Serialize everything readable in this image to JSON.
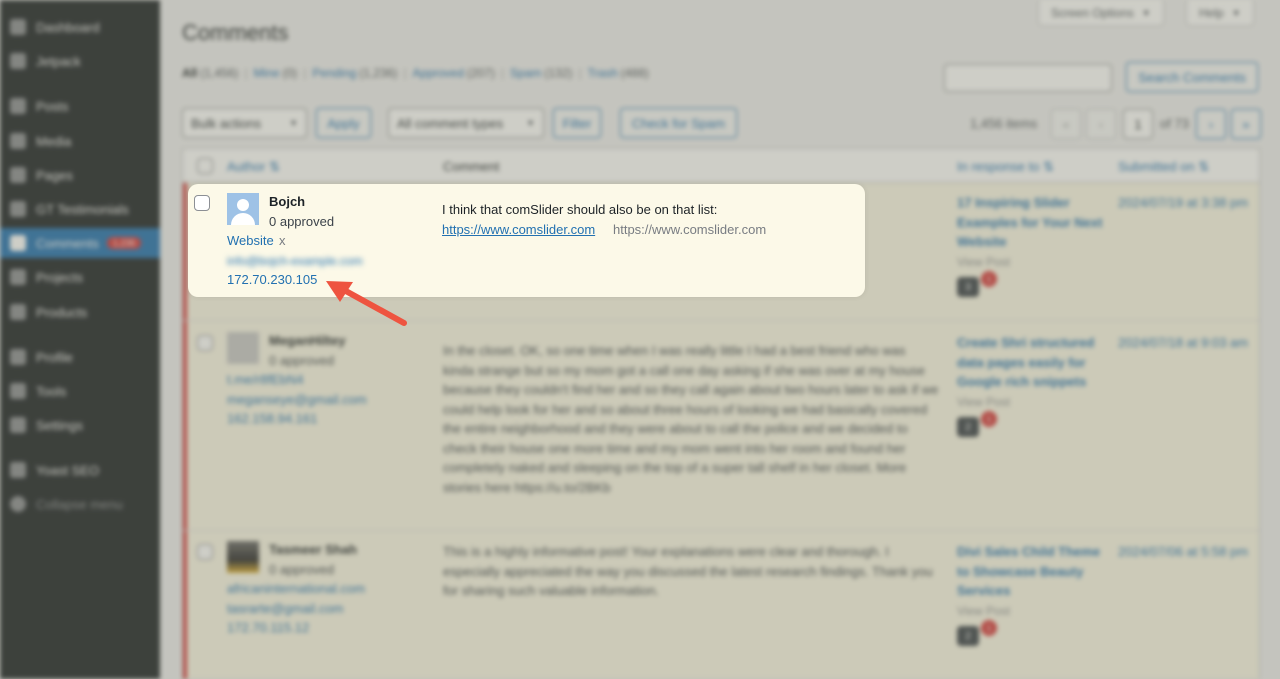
{
  "sidebar": {
    "items": [
      {
        "label": "Dashboard"
      },
      {
        "label": "Jetpack"
      },
      {
        "label": "Posts"
      },
      {
        "label": "Media"
      },
      {
        "label": "Pages"
      },
      {
        "label": "GT Testimonials"
      },
      {
        "label": "Comments",
        "badge": "1,236"
      },
      {
        "label": "Projects"
      },
      {
        "label": "Products"
      },
      {
        "label": "Profile"
      },
      {
        "label": "Tools"
      },
      {
        "label": "Settings"
      },
      {
        "label": "Yoast SEO"
      },
      {
        "label": "Collapse menu"
      }
    ]
  },
  "header": {
    "title": "Comments",
    "screen_options": "Screen Options",
    "help": "Help"
  },
  "filters": {
    "all": {
      "label": "All",
      "count": "(1,456)"
    },
    "mine": {
      "label": "Mine",
      "count": "(0)"
    },
    "pending": {
      "label": "Pending",
      "count": "(1,236)"
    },
    "approved": {
      "label": "Approved",
      "count": "(207)"
    },
    "spam": {
      "label": "Spam",
      "count": "(132)"
    },
    "trash": {
      "label": "Trash",
      "count": "(488)"
    }
  },
  "search": {
    "button": "Search Comments"
  },
  "toolbar": {
    "bulk_actions": "Bulk actions",
    "apply": "Apply",
    "comment_types": "All comment types",
    "filter": "Filter",
    "check_spam": "Check for Spam",
    "items_count": "1,456 items",
    "first": "«",
    "prev": "‹",
    "page": "1",
    "of_pages": "of 73",
    "next": "›",
    "last": "»"
  },
  "table": {
    "headers": {
      "author": "Author",
      "comment": "Comment",
      "in_response_to": "In response to",
      "submitted_on": "Submitted on"
    },
    "rows": [
      {
        "author": "Bojch",
        "approved": "0 approved",
        "website": "Website",
        "website_x": "x",
        "email": "info@bojch-example.com",
        "ip": "172.70.230.105",
        "comment": "I think that comSlider should also be on that list:",
        "comment_link": "https://www.comslider.com",
        "comment_link_plain": "https://www.comslider.com",
        "response": "17 Inspiring Slider Examples for Your Next Website",
        "view_post": "View Post",
        "comments_count": "3",
        "pending_count": "1",
        "submitted": "2024/07/19 at 3:38 pm"
      },
      {
        "author": "MeganHiltey",
        "approved": "0 approved",
        "website": "t.me/r8fEbN4",
        "email": "meganseye@gmail.com",
        "ip": "162.158.94.161",
        "comment": "In the closet. OK, so one time when I was really little I had a best friend who was kinda strange but so my mom got a call one day asking if she was over at my house because they couldn't find her and so they call again about two hours later to ask if we could help look for her and so about three hours of looking we had basically covered the entire neighborhood and they were about to call the police and we decided to check their house one more time and my mom went into her room and found her completely naked and sleeping on the top of a super tall shelf in her closet. More stories here https://u.to/2BKb",
        "comment_plain": "https://u.to/2BKb",
        "response": "Create Shri structured data pages easily for Google rich snippets",
        "view_post": "View Post",
        "comments_count": "2",
        "pending_count": "1",
        "submitted": "2024/07/18 at 9:03 am"
      },
      {
        "author": "Tasmeer Shah",
        "approved": "0 approved",
        "website": "africaninternational.com",
        "email": "tasrarte@gmail.com",
        "ip": "172.70.115.12",
        "comment": "This is a highly informative post! Your explanations were clear and thorough. I especially appreciated the way you discussed the latest research findings. Thank you for sharing such valuable information.",
        "response": "Divi Sales Child Theme to Showcase Beauty Services",
        "view_post": "View Post",
        "comments_count": "2",
        "pending_count": "1",
        "submitted": "2024/07/06 at 5:58 pm"
      }
    ]
  },
  "colors": {
    "accent": "#2271b1",
    "sidebar": "#1d2327",
    "highlight_bg": "#fcf9e8",
    "arrow": "#ee5440"
  },
  "icons": [
    "dashboard-icon",
    "jetpack-icon",
    "posts-icon",
    "media-icon",
    "pages-icon",
    "testimonials-icon",
    "comments-icon",
    "projects-icon",
    "products-icon",
    "profile-icon",
    "tools-icon",
    "settings-icon",
    "yoast-icon",
    "collapse-icon",
    "comment-bubble-icon",
    "sort-icon",
    "chevron-down-icon",
    "arrow-annotation-icon"
  ]
}
